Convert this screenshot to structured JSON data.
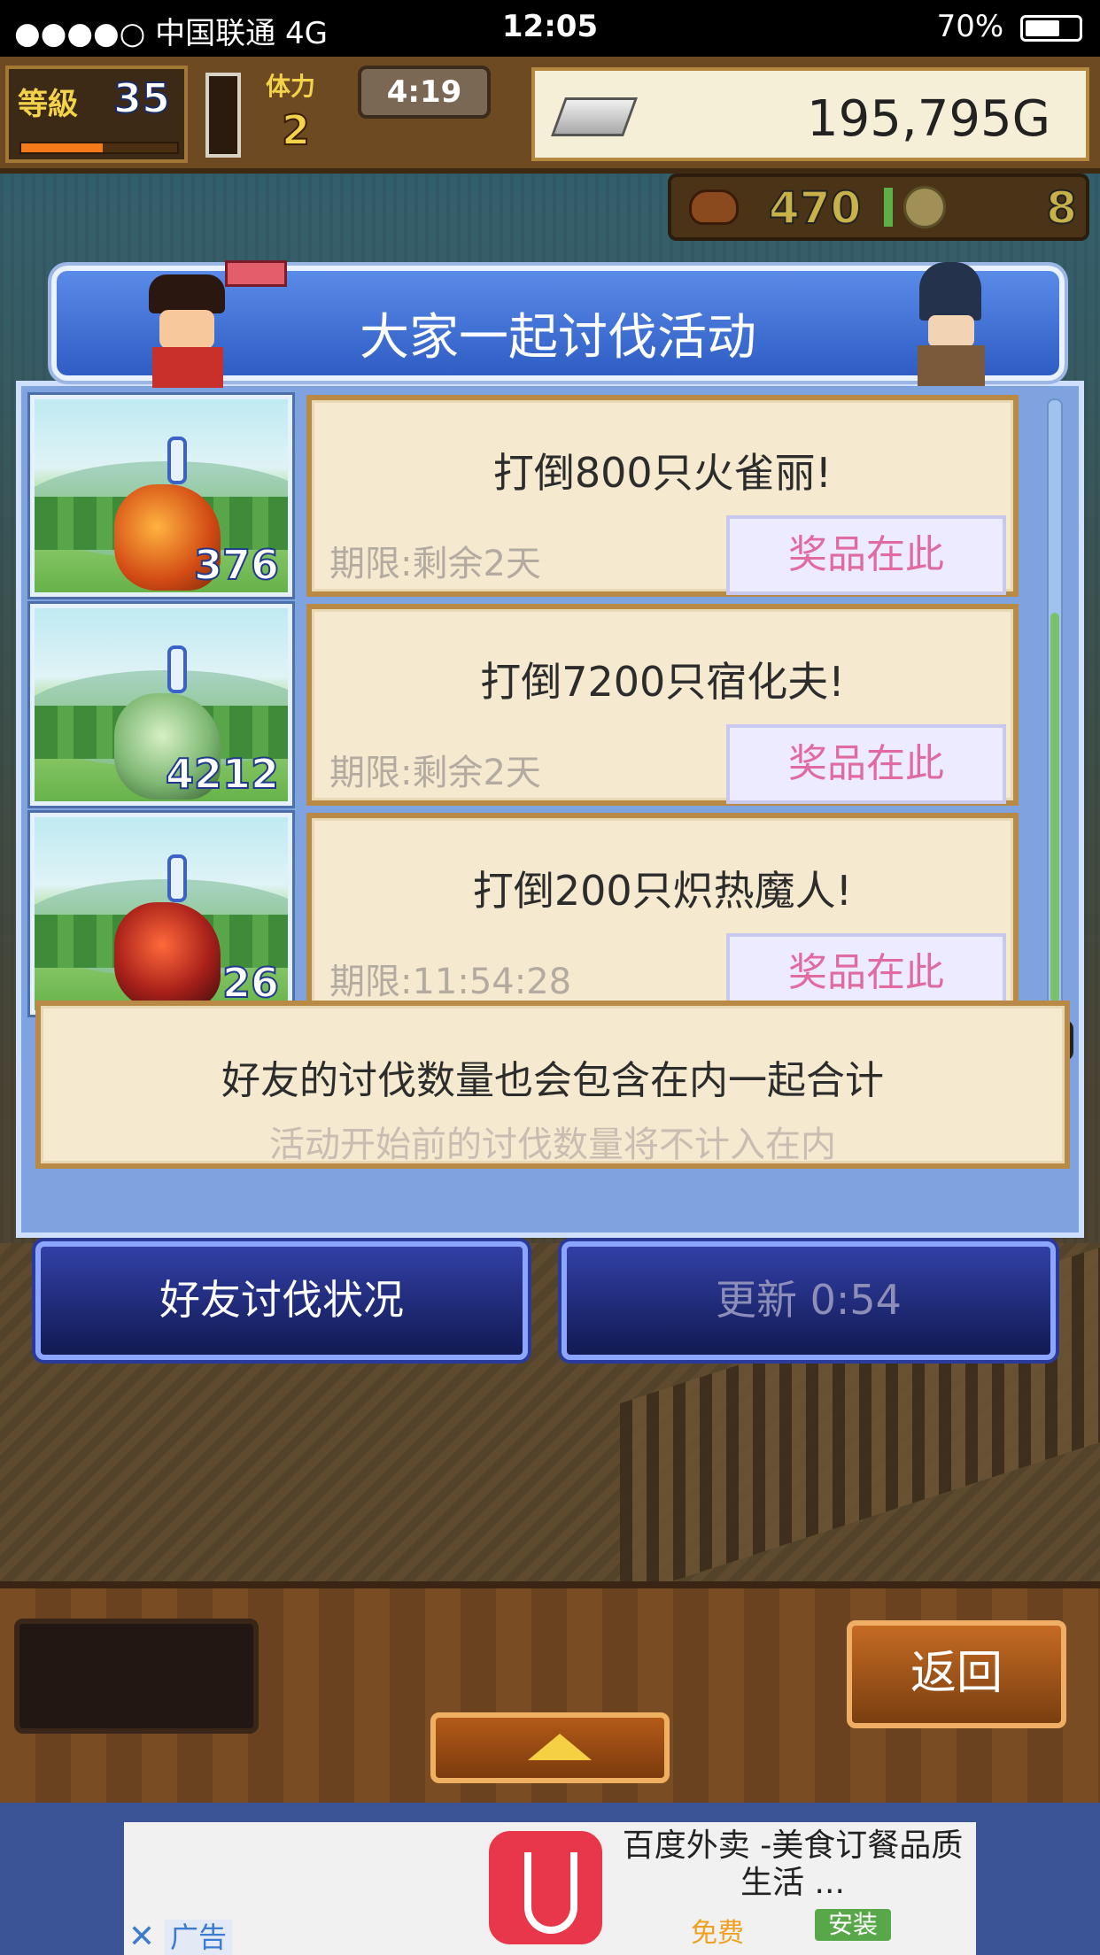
{
  "status_bar": {
    "carrier": "●●●●○ 中国联通   4G",
    "time": "12:05",
    "battery": "70%"
  },
  "hud": {
    "level_label": "等級",
    "level": "35",
    "level_progress": 0.52,
    "rank_label": "体力",
    "rank_value": "2",
    "timer": "4:19",
    "gold": "195,795G",
    "resource_1": "470",
    "resource_2": "8"
  },
  "dialog": {
    "title": "大家一起讨伐活动",
    "events": [
      {
        "goal": "打倒800只火雀丽!",
        "deadline": "期限:剩余2天",
        "reward": "奖品在此",
        "count": "376"
      },
      {
        "goal": "打倒7200只宿化夫!",
        "deadline": "期限:剩余2天",
        "reward": "奖品在此",
        "count": "4212"
      },
      {
        "goal": "打倒200只炽热魔人!",
        "deadline": "期限:11:54:28",
        "reward": "奖品在此",
        "count": "26"
      }
    ],
    "note_line1": "好友的讨伐数量也会包含在内一起合计",
    "note_line2": "活动开始前的讨伐数量将不计入在内",
    "friends_button": "好友讨伐状况",
    "update_button": "更新 0:54"
  },
  "bottom": {
    "return_button": "返回"
  },
  "ad": {
    "label": "广告",
    "close": "✕",
    "title": "百度外卖 -美食订餐品质生活 ...",
    "free": "免费",
    "install": "安装"
  },
  "colors": {
    "dialog_blue": "#2f5dc4",
    "card_beige": "#f5e9cf",
    "reward_pink": "#e06aa2",
    "button_navy": "#111a52"
  }
}
